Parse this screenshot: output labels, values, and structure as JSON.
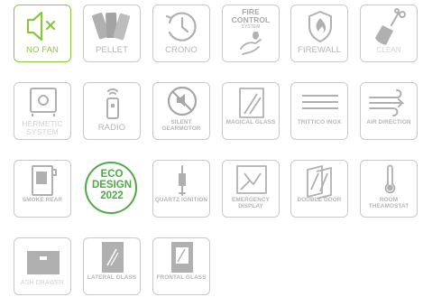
{
  "colors": {
    "active": "#8cc63f",
    "eco": "#4daa46",
    "icon": "#b0b0b0",
    "border": "#c9c9c9"
  },
  "tiles": [
    {
      "icon": "speaker-muted-icon",
      "label": "NO FAN",
      "active": true
    },
    {
      "icon": "pellet-swatch-icon",
      "label": "PELLET"
    },
    {
      "icon": "clock-icon",
      "label": "CRONO"
    },
    {
      "icon": "fire-control-hand-icon",
      "title": [
        "FIRE",
        "CONTROL",
        "SYSTEM"
      ]
    },
    {
      "icon": "flame-shield-icon",
      "label": "FIREWALL"
    },
    {
      "icon": "broom-icon",
      "label": "CLEAN"
    },
    {
      "icon": "safe-box-icon",
      "label": "HERMETIC SYSTEM"
    },
    {
      "icon": "remote-control-icon",
      "label": "RADIO"
    },
    {
      "icon": "silent-motor-icon",
      "label": "SILENT GEARMOTOR"
    },
    {
      "icon": "glass-panel-icon",
      "label": "MAGICAL GLASS"
    },
    {
      "icon": "triple-lines-icon",
      "label": "TRITTICO INOX"
    },
    {
      "icon": "air-flow-icon",
      "label": "AIR DIRECTION"
    },
    {
      "icon": "stove-rear-icon",
      "label": "SMOKE REAR"
    },
    {
      "eco": [
        "ECO",
        "DESIGN",
        "2022"
      ]
    },
    {
      "icon": "quartz-igniter-icon",
      "label": "QUARTZ IGNITION"
    },
    {
      "icon": "broken-display-icon",
      "label": "EMERGENCY DISPLAY"
    },
    {
      "icon": "double-door-icon",
      "label": "DOUBLE DOOR"
    },
    {
      "icon": "thermometer-icon",
      "label": "ROOM THEAMOSTAT"
    },
    {
      "icon": "ash-drawer-icon",
      "label": "ASH DRAWER"
    },
    {
      "icon": "stove-lateral-icon",
      "label": "LATERAL GLASS"
    },
    {
      "icon": "stove-frontal-icon",
      "label": "FRONTAL GLASS"
    }
  ]
}
